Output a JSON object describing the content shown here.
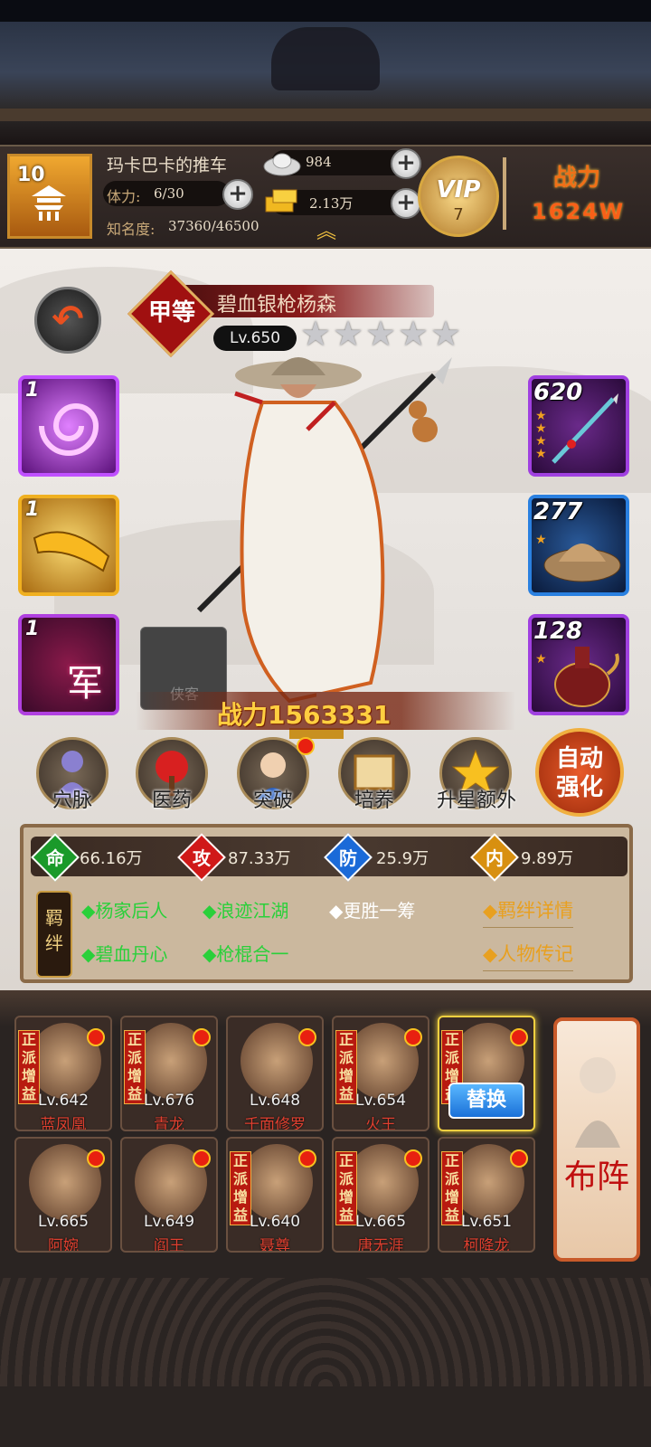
{
  "top": {
    "player_name": "玛卡巴卡的推车",
    "level": "10",
    "stamina_label": "体力:",
    "stamina": "6/30",
    "fame_label": "知名度:",
    "fame": "37360/46500",
    "silver": "984",
    "gold": "2.13万",
    "vip_label": "VIP",
    "vip_level": "7",
    "power_label": "战力",
    "power_value": "1624W"
  },
  "hero": {
    "name": "碧血银枪杨森",
    "grade": "甲等",
    "level": "Lv.650",
    "stars": 5,
    "power": "战力1563331",
    "companion_label": "侠客"
  },
  "skills": [
    {
      "icon": "purple-vortex-skill-icon",
      "count": "1"
    },
    {
      "icon": "golden-horn-skill-icon",
      "count": "1"
    },
    {
      "icon": "army-skill-icon",
      "count": "1",
      "text": "军"
    }
  ],
  "equipment": [
    {
      "icon": "spear-icon",
      "level": "620",
      "stars": 4
    },
    {
      "icon": "bamboo-hat-icon",
      "level": "277",
      "stars": 1
    },
    {
      "icon": "vase-icon",
      "level": "128",
      "stars": 1
    }
  ],
  "functions": [
    {
      "label": "穴脉",
      "icon": "meridian-icon"
    },
    {
      "label": "医药",
      "icon": "medicine-icon"
    },
    {
      "label": "突破",
      "icon": "breakthrough-icon"
    },
    {
      "label": "培养",
      "icon": "training-scroll-icon"
    },
    {
      "label": "升星额外",
      "icon": "star-up-icon"
    }
  ],
  "auto_enhance": "自动强化",
  "stats": [
    {
      "name": "命",
      "value": "66.16万",
      "color": "#1a9a2a"
    },
    {
      "name": "攻",
      "value": "87.33万",
      "color": "#d01818"
    },
    {
      "name": "防",
      "value": "25.9万",
      "color": "#1a6ad8"
    },
    {
      "name": "内",
      "value": "9.89万",
      "color": "#d89010"
    }
  ],
  "bond_label": "羁绊",
  "bonds": [
    {
      "text": "◆杨家后人",
      "color": "#2ad03a"
    },
    {
      "text": "◆浪迹江湖",
      "color": "#2ad03a"
    },
    {
      "text": "◆更胜一筹",
      "color": "#ffffff"
    },
    {
      "text": "◆碧血丹心",
      "color": "#2ad03a"
    },
    {
      "text": "◆枪棍合一",
      "color": "#2ad03a"
    }
  ],
  "links": {
    "bond_detail": "◆羁绊详情",
    "biography": "◆人物传记"
  },
  "roster_tag": "正派增益",
  "roster": [
    {
      "level": "Lv.642",
      "name": "蓝凤凰",
      "tag": true
    },
    {
      "level": "Lv.676",
      "name": "青龙",
      "tag": true
    },
    {
      "level": "Lv.648",
      "name": "千面修罗",
      "tag": false
    },
    {
      "level": "Lv.654",
      "name": "火王",
      "tag": true
    },
    {
      "level": "",
      "name": "",
      "tag": true,
      "selected": true
    },
    {
      "level": "Lv.665",
      "name": "阿婉",
      "tag": false
    },
    {
      "level": "Lv.649",
      "name": "阎王",
      "tag": false
    },
    {
      "level": "Lv.640",
      "name": "聂尊",
      "tag": true
    },
    {
      "level": "Lv.665",
      "name": "唐无涯",
      "tag": true
    },
    {
      "level": "Lv.651",
      "name": "柯降龙",
      "tag": true
    }
  ],
  "replace_button": "替换",
  "formation_button": "布阵"
}
